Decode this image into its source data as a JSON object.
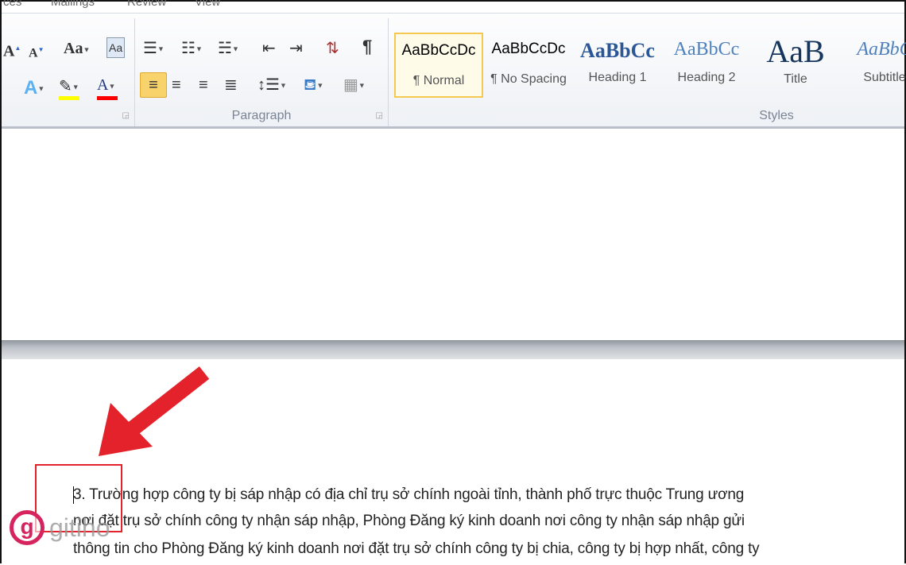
{
  "tabs": [
    "ces",
    "Mailings",
    "Review",
    "View"
  ],
  "ribbon": {
    "groups": {
      "paragraph": "Paragraph",
      "styles": "Styles"
    },
    "styles": [
      {
        "sample": "AaBbCcDc",
        "name": "¶ Normal",
        "selected": true
      },
      {
        "sample": "AaBbCcDc",
        "name": "¶ No Spacing"
      },
      {
        "sample": "AaBbCc",
        "name": "Heading 1"
      },
      {
        "sample": "AaBbCc",
        "name": "Heading 2"
      },
      {
        "sample": "AaB",
        "name": "Title"
      },
      {
        "sample": "AaBbC",
        "name": "Subtitle"
      }
    ],
    "colors": {
      "highlight": "#ffff00",
      "font_color": "#ff0000",
      "align_selected": "#f8d26a"
    }
  },
  "document": {
    "lines": [
      "3. Trường hợp công ty bị sáp nhập có địa chỉ trụ sở chính ngoài tỉnh, thành phố trực thuộc Trung ương",
      "nơi đặt trụ sở chính công ty nhận sáp nhập, Phòng Đăng ký kinh doanh nơi công ty nhận sáp nhập gửi",
      "thông tin cho Phòng Đăng ký kinh doanh nơi đặt trụ sở chính công ty bị chia, công ty bị hợp nhất, công ty"
    ]
  },
  "watermark": {
    "letter": "g",
    "text": "gitiho"
  },
  "annotation_color": "#e3222b"
}
